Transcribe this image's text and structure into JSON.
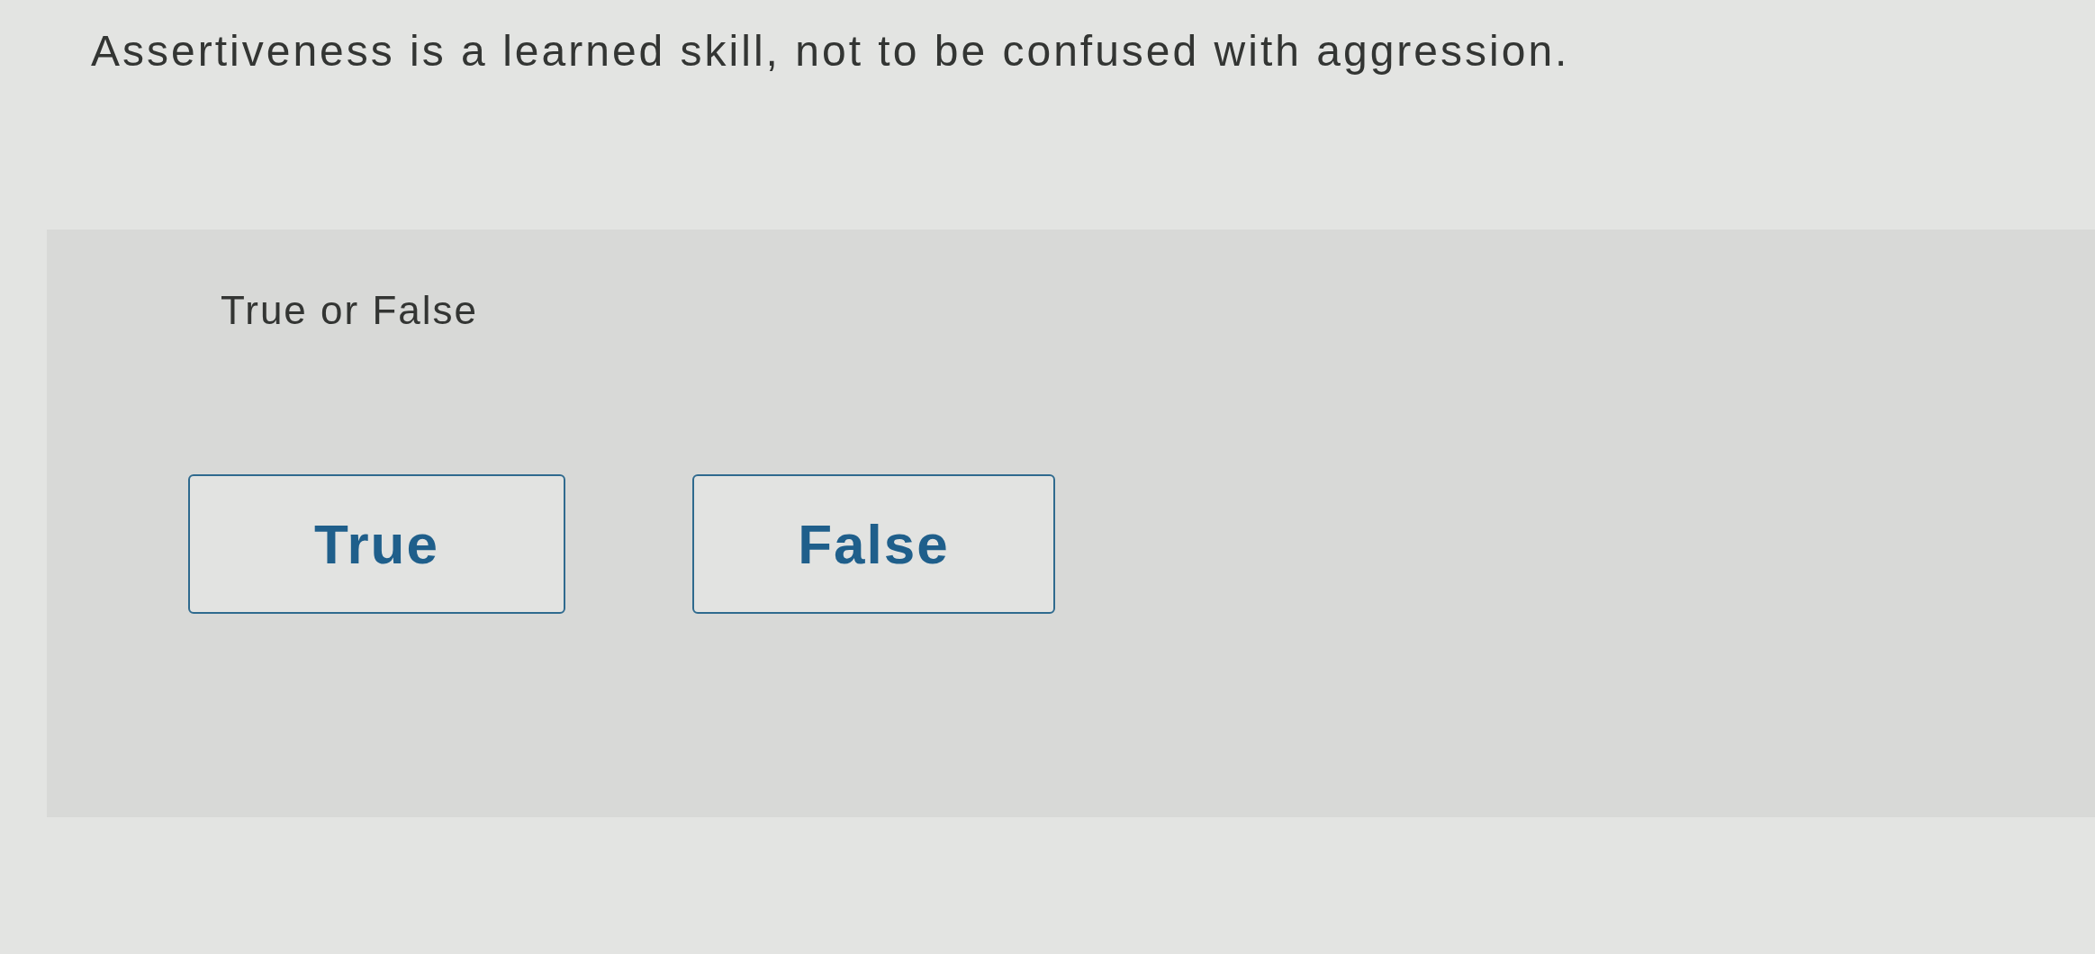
{
  "question": {
    "text": "Assertiveness is a learned skill, not to be confused with aggression."
  },
  "answer_panel": {
    "prompt": "True or False",
    "options": [
      {
        "label": "True",
        "selected": false
      },
      {
        "label": "False",
        "selected": false
      }
    ]
  }
}
